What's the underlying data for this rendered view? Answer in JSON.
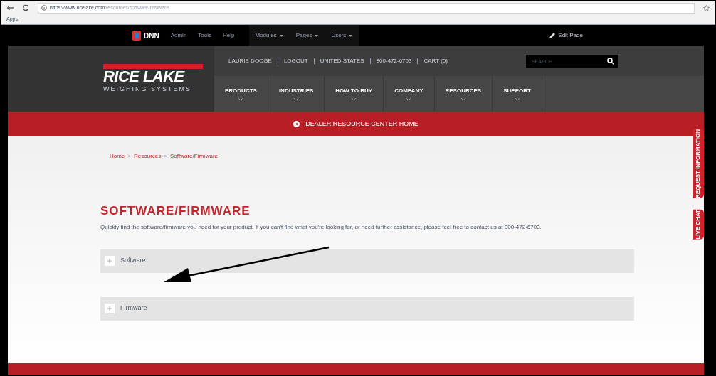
{
  "browser": {
    "url_host": "https://www.ricelake.com",
    "url_path": "/resources/software-firmware",
    "bookmarks": [
      "Apps"
    ]
  },
  "admin_bar": {
    "logo": "DNN",
    "links": [
      "Admin",
      "Tools",
      "Help"
    ],
    "menus": [
      "Modules",
      "Pages",
      "Users"
    ],
    "edit": "Edit Page"
  },
  "header": {
    "brand": "RICE LAKE",
    "tagline": "WEIGHING SYSTEMS",
    "utility": [
      "LAURIE DOOGE",
      "LOGOUT",
      "UNITED STATES",
      "800-472-6703",
      "CART (0)"
    ],
    "search": {
      "placeholder": "SEARCH"
    },
    "nav": [
      "PRODUCTS",
      "INDUSTRIES",
      "HOW TO BUY",
      "COMPANY",
      "RESOURCES",
      "SUPPORT"
    ]
  },
  "dealer_bar": "DEALER RESOURCE CENTER HOME",
  "breadcrumb": {
    "items": [
      "Home",
      "Resources",
      "Software/Firmware"
    ],
    "separator": ">"
  },
  "title": "SOFTWARE/FIRMWARE",
  "intro": "Quickly find the software/firmware you need for your product. If you can't find what you're looking for, or need further assistance, please feel free to contact us at 800-472-6703.",
  "sections": [
    {
      "label": "Software",
      "expanded": false
    },
    {
      "label": "Firmware",
      "expanded": false
    }
  ],
  "side_tabs": [
    "REQUEST INFORMATION",
    "LIVE CHAT"
  ]
}
